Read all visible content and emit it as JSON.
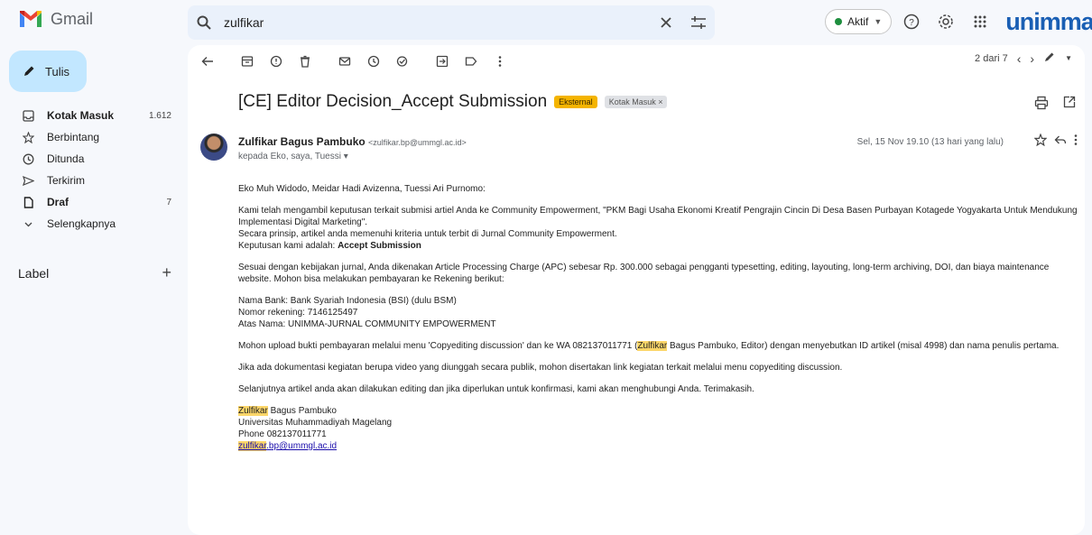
{
  "app": {
    "name": "Gmail",
    "brand": "unimma",
    "account_initial": "M"
  },
  "search": {
    "query": "zulfikar"
  },
  "status": {
    "label": "Aktif"
  },
  "compose": {
    "label": "Tulis"
  },
  "nav": [
    {
      "label": "Kotak Masuk",
      "count": "1.612",
      "icon": "inbox-icon",
      "bold": true
    },
    {
      "label": "Berbintang",
      "count": "",
      "icon": "star-icon",
      "bold": false
    },
    {
      "label": "Ditunda",
      "count": "",
      "icon": "clock-icon",
      "bold": false
    },
    {
      "label": "Terkirim",
      "count": "",
      "icon": "send-icon",
      "bold": false
    },
    {
      "label": "Draf",
      "count": "7",
      "icon": "draft-icon",
      "bold": true
    },
    {
      "label": "Selengkapnya",
      "count": "",
      "icon": "chevron-down-icon",
      "bold": false
    }
  ],
  "labels": {
    "title": "Label"
  },
  "pager": {
    "text": "2 dari 7"
  },
  "email": {
    "subject": "[CE] Editor Decision_Accept Submission",
    "tag_external": "Eksternal",
    "tag_inbox": "Kotak Masuk ×",
    "sender_name": "Zulfikar Bagus Pambuko",
    "sender_email": "<zulfikar.bp@ummgl.ac.id>",
    "recipients": "kepada Eko, saya, Tuessi ▾",
    "date": "Sel, 15 Nov 19.10 (13 hari yang lalu)",
    "greeting": "Eko Muh Widodo, Meidar Hadi Avizenna, Tuessi Ari Purnomo:",
    "p1_l1": "Kami telah mengambil keputusan terkait submisi artiel Anda ke Community Empowerment, \"PKM Bagi Usaha Ekonomi Kreatif Pengrajin Cincin Di Desa Basen Purbayan Kotagede Yogyakarta Untuk Mendukung Implementasi Digital Marketing\".",
    "p1_l2": "Secara prinsip, artikel anda memenuhi kriteria untuk terbit di Jurnal Community Empowerment.",
    "p1_l3": "Keputusan kami adalah: ",
    "p1_decision": "Accept Submission",
    "p2": "Sesuai dengan kebijakan jurnal, Anda dikenakan Article Processing Charge (APC) sebesar Rp. 300.000 sebagai pengganti typesetting, editing, layouting, long-term archiving, DOI, dan biaya maintenance website. Mohon bisa melakukan pembayaran ke Rekening berikut:",
    "bank_1": "Nama Bank: Bank Syariah Indonesia (BSI) (dulu BSM)",
    "bank_2": "Nomor rekening: 7146125497",
    "bank_3": "Atas Nama: UNIMMA-JURNAL COMMUNITY EMPOWERMENT",
    "p3_a": "Mohon upload bukti pembayaran melalui menu 'Copyediting discussion' dan ke WA 082137011771 (",
    "p3_hl": "Zulfikar",
    "p3_b": " Bagus Pambuko, Editor) dengan menyebutkan ID artikel (misal 4998) dan nama penulis pertama.",
    "p4": "Jika ada dokumentasi kegiatan berupa video yang diunggah secara publik, mohon disertakan link kegiatan terkait melalui menu copyediting discussion.",
    "p5": "Selanjutnya artikel anda akan dilakukan editing dan jika diperlukan untuk konfirmasi, kami akan menghubungi Anda. Terimakasih.",
    "sig_hl": "Zulfikar",
    "sig_name_rest": " Bagus Pambuko",
    "sig_org": "Universitas Muhammadiyah Magelang",
    "sig_phone": "Phone 082137011771",
    "sig_email_hl": "zulfikar",
    "sig_email_rest": ".bp@ummgl.ac.id"
  }
}
